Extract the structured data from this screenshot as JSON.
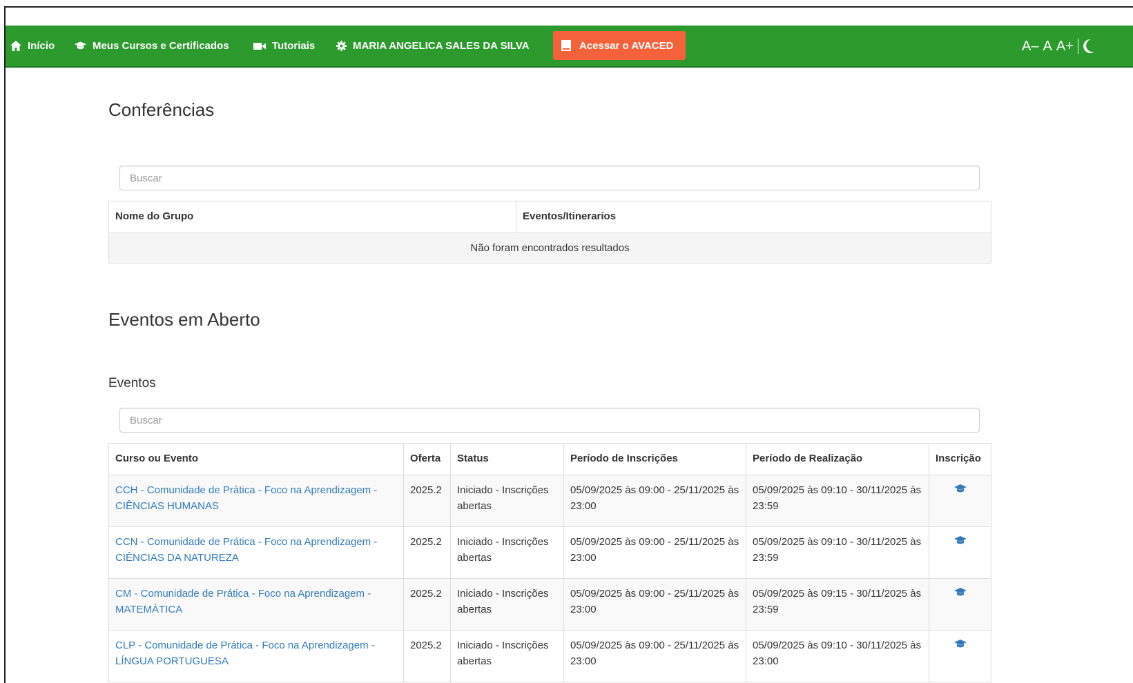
{
  "navbar": {
    "home": "Início",
    "courses": "Meus Cursos e Certificados",
    "tutorials": "Tutoriais",
    "user": "MARIA ANGELICA SALES DA SILVA",
    "cta": "Acessar o AVACED",
    "font_decrease": "A–",
    "font_normal": "A",
    "font_increase": "A+",
    "colors": {
      "bar": "#2d9a2d",
      "cta": "#f4613a"
    }
  },
  "conferencias": {
    "title": "Conferências",
    "search_placeholder": "Buscar",
    "columns": [
      "Nome do Grupo",
      "Eventos/Itinerarios"
    ],
    "empty_message": "Não foram encontrados resultados"
  },
  "eventos_aberto": {
    "title": "Eventos em Aberto",
    "subtitle": "Eventos",
    "search_placeholder": "Buscar",
    "columns": [
      "Curso ou Evento",
      "Oferta",
      "Status",
      "Período de Inscrições",
      "Período de Realização",
      "Inscrição"
    ],
    "rows": [
      {
        "name": "CCH - Comunidade de Prática - Foco na Aprendizagem - CIÊNCIAS HUMANAS",
        "oferta": "2025.2",
        "status": "Iniciado - Inscrições abertas",
        "inscricoes": "05/09/2025 às 09:00 - 25/11/2025 às 23:00",
        "realizacao": "05/09/2025 às 09:10 - 30/11/2025 às 23:59",
        "icon": "graduation-cap-icon"
      },
      {
        "name": "CCN - Comunidade de Prática - Foco na Aprendizagem - CIÊNCIAS DA NATUREZA",
        "oferta": "2025.2",
        "status": "Iniciado - Inscrições abertas",
        "inscricoes": "05/09/2025 às 09:00 - 25/11/2025 às 23:00",
        "realizacao": "05/09/2025 às 09:10 - 30/11/2025 às 23:59",
        "icon": "graduation-cap-icon"
      },
      {
        "name": "CM - Comunidade de Prática - Foco na Aprendizagem - MATEMÁTICA",
        "oferta": "2025.2",
        "status": "Iniciado - Inscrições abertas",
        "inscricoes": "05/09/2025 às 09:00 - 25/11/2025 às 23:00",
        "realizacao": "05/09/2025 às 09:15 - 30/11/2025 às 23:59",
        "icon": "graduation-cap-icon"
      },
      {
        "name": "CLP - Comunidade de Prática - Foco na Aprendizagem - LÍNGUA PORTUGUESA",
        "oferta": "2025.2",
        "status": "Iniciado - Inscrições abertas",
        "inscricoes": "05/09/2025 às 09:00 - 25/11/2025 às 23:00",
        "realizacao": "05/09/2025 às 09:10 - 30/11/2025 às 23:00",
        "icon": "graduation-cap-icon"
      }
    ]
  }
}
